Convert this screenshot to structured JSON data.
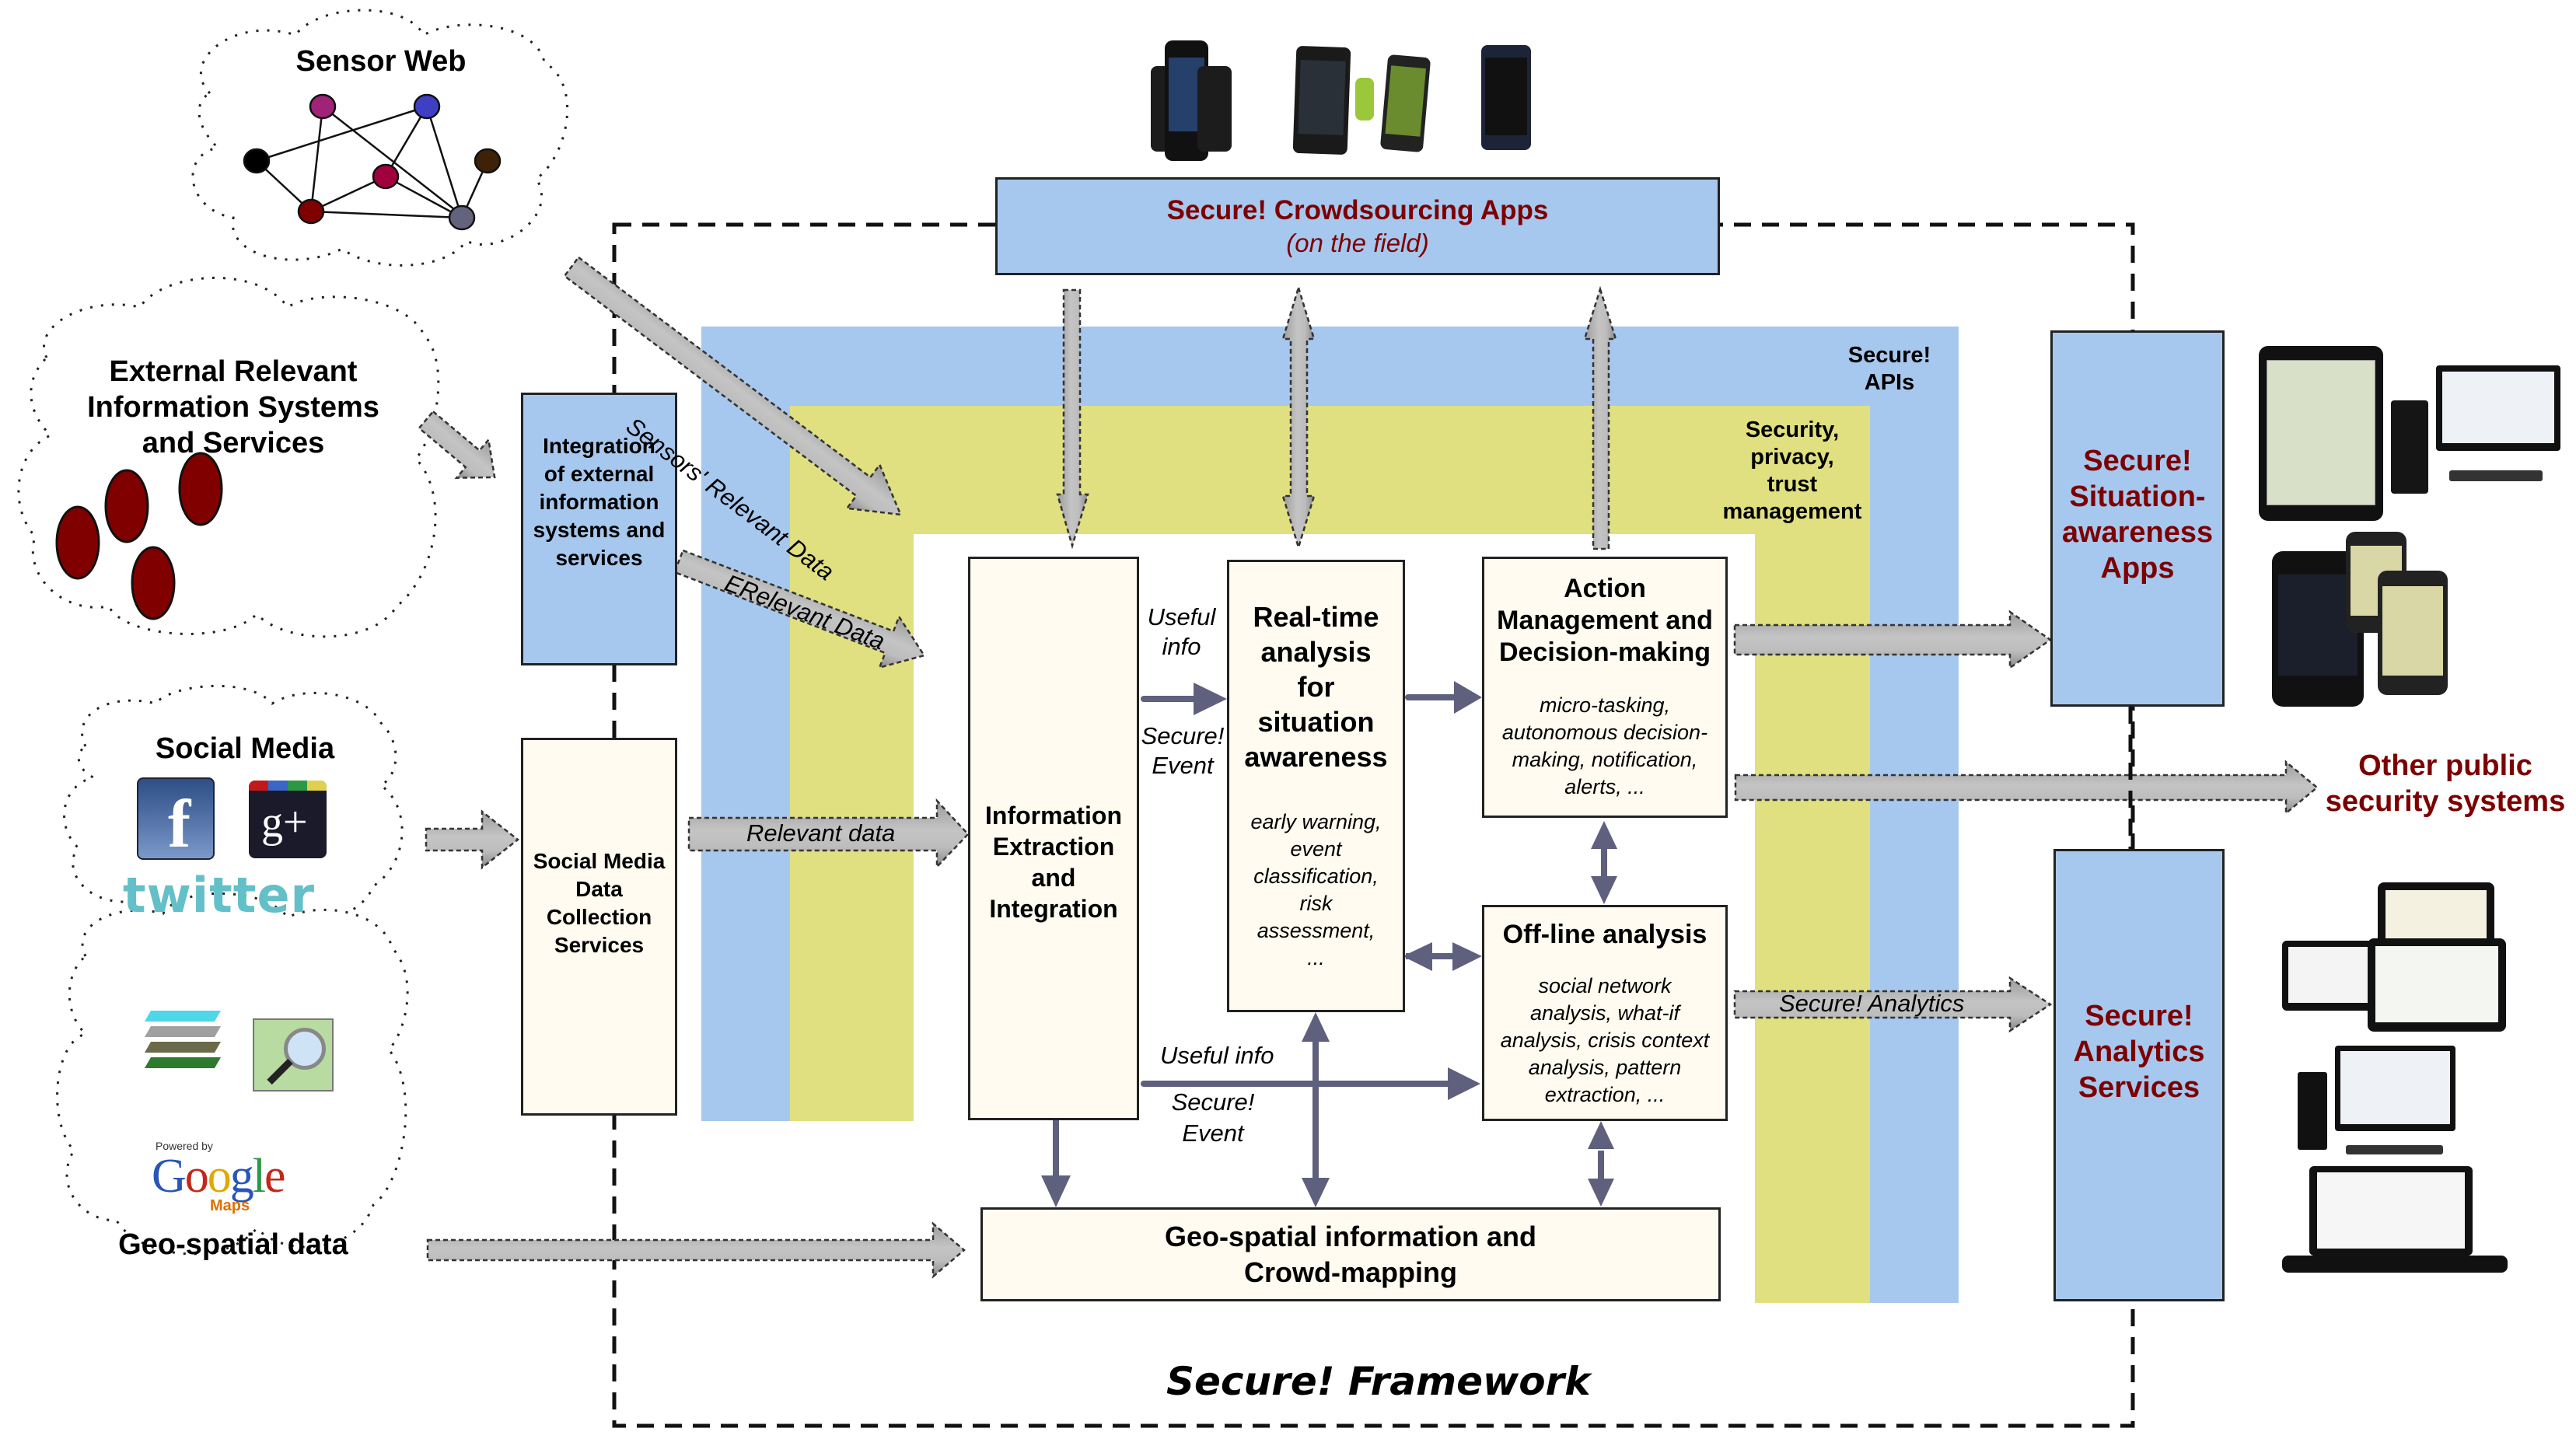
{
  "clouds": {
    "sensor_web": {
      "title": "Sensor Web"
    },
    "external": {
      "title_lines": [
        "External Relevant",
        "Information Systems",
        "and Services"
      ]
    },
    "social_media": {
      "title": "Social Media",
      "logos": [
        "facebook-logo",
        "google-plus-logo",
        "twitter-logo"
      ],
      "twitter_text": "twitter"
    },
    "geo_spatial": {
      "title": "Geo-spatial data",
      "powered_by": "Powered by",
      "google": "Google",
      "maps": "Maps"
    }
  },
  "boxes": {
    "crowdsourcing": {
      "title": "Secure! Crowdsourcing Apps",
      "subtitle": "(on the field)"
    },
    "integration_external": {
      "lines": [
        "Integration",
        "of external",
        "information",
        "systems and",
        "services"
      ]
    },
    "social_media_collection": {
      "lines": [
        "Social Media",
        "Data",
        "Collection",
        "Services"
      ]
    },
    "info_extraction": {
      "lines": [
        "Information",
        "Extraction",
        "and",
        "Integration"
      ]
    },
    "realtime": {
      "title_lines": [
        "Real-time",
        "analysis",
        "for",
        "situation",
        "awareness"
      ],
      "detail_lines": [
        "early warning,",
        "event",
        "classification,",
        "risk",
        "assessment,",
        "..."
      ]
    },
    "action": {
      "title_lines": [
        "Action",
        "Management and",
        "Decision-making"
      ],
      "detail_lines": [
        "micro-tasking,",
        "autonomous decision-",
        "making, notification,",
        "alerts, ..."
      ]
    },
    "offline": {
      "title": "Off-line analysis",
      "detail_lines": [
        "social network",
        "analysis, what-if",
        "analysis, crisis context",
        "analysis, pattern",
        "extraction, ..."
      ]
    },
    "geo_info": {
      "lines": [
        "Geo-spatial information and",
        "Crowd-mapping"
      ]
    },
    "situation_apps": {
      "lines": [
        "Secure!",
        "Situation-",
        "awareness",
        "Apps"
      ]
    },
    "analytics_services": {
      "lines": [
        "Secure!",
        "Analytics",
        "Services"
      ]
    }
  },
  "layers": {
    "apis": {
      "lines": [
        "Secure!",
        "APIs"
      ]
    },
    "security": {
      "lines": [
        "Security,",
        "privacy,",
        "trust",
        "management"
      ]
    }
  },
  "arrow_labels": {
    "sensors_data": "Sensors' Relevant Data",
    "external_data": "ERelevant Data",
    "relevant_data": "Relevant data",
    "useful_info_top": [
      "Useful",
      "info"
    ],
    "secure_event_top": [
      "Secure!",
      "Event"
    ],
    "useful_info_bottom": "Useful info",
    "secure_event_bottom": [
      "Secure!",
      "Event"
    ],
    "analytics": "Secure! Analytics"
  },
  "outputs": {
    "other_systems": [
      "Other public",
      "security systems"
    ]
  },
  "framework_title": "Secure! Framework",
  "device_images": [
    "smartphones-image",
    "tablet-desktop-image",
    "iphones-map-image",
    "dashboards-image"
  ],
  "colors": {
    "blue_layer": "#a7c8ee",
    "yellow_layer": "#e0e080",
    "cream_box": "#fffbf0",
    "dark_red_text": "#7d0000",
    "connector": "#5f607e",
    "big_arrow": "#bdbdbd"
  }
}
